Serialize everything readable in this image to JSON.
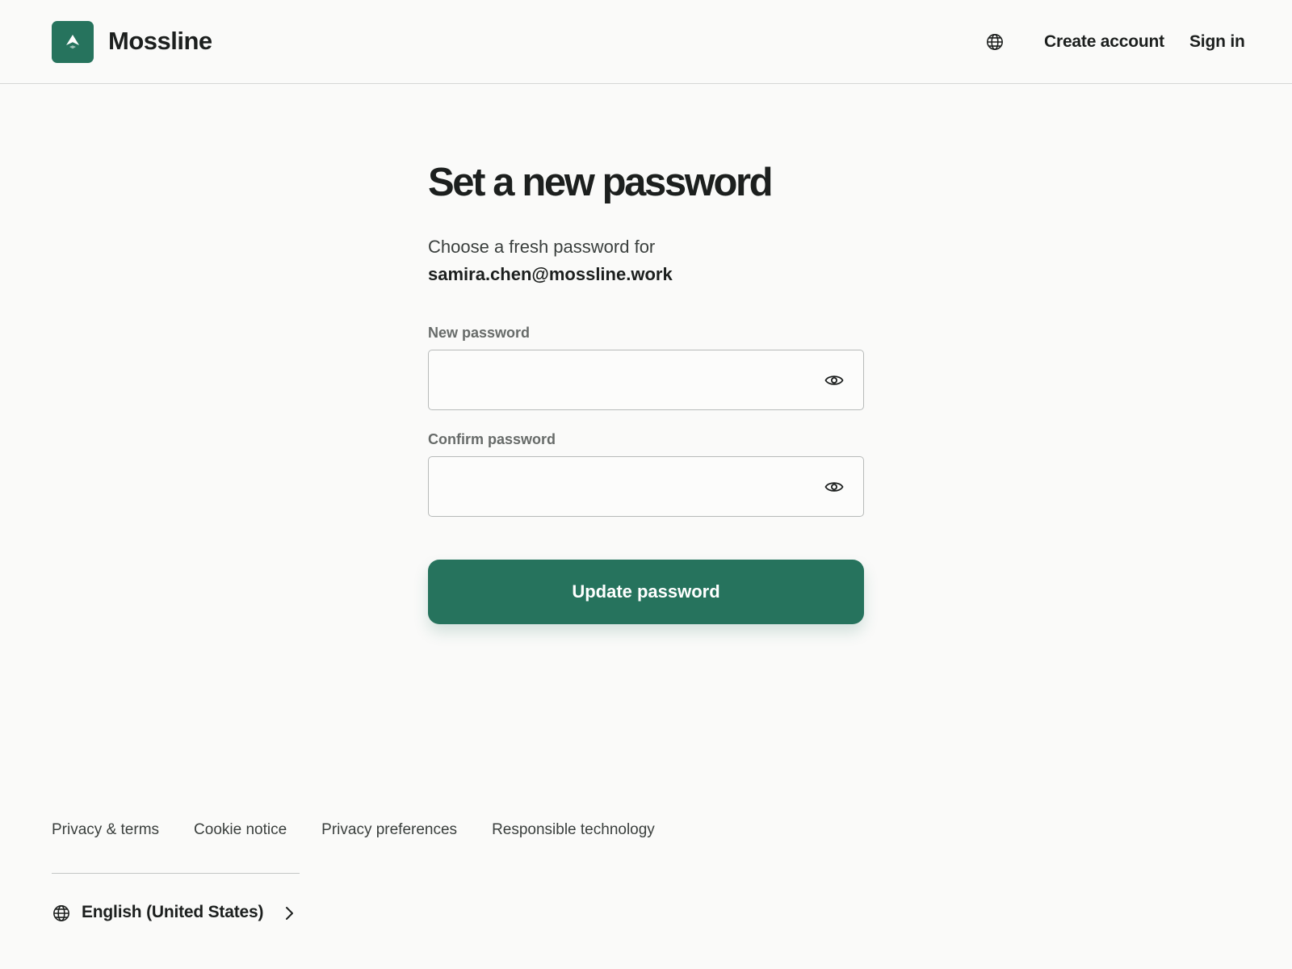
{
  "header": {
    "brand": "Mossline",
    "brand_color": "#26735d",
    "logo_icon": "mountain-peak-icon",
    "language_icon": "globe-icon",
    "create_account": "Create account",
    "sign_in": "Sign in"
  },
  "main": {
    "title": "Set a new password",
    "intro": "Choose a fresh password for",
    "email": "samira.chen@mossline.work",
    "fields": [
      {
        "label": "New password",
        "value": "",
        "toggle_icon": "eye-icon"
      },
      {
        "label": "Confirm password",
        "value": "",
        "toggle_icon": "eye-icon"
      }
    ],
    "submit_label": "Update password"
  },
  "footer": {
    "links": [
      "Privacy & terms",
      "Cookie notice",
      "Privacy preferences",
      "Responsible technology"
    ],
    "language": "English (United States)",
    "language_icon": "globe-icon",
    "language_chevron": "chevron-right-icon"
  }
}
